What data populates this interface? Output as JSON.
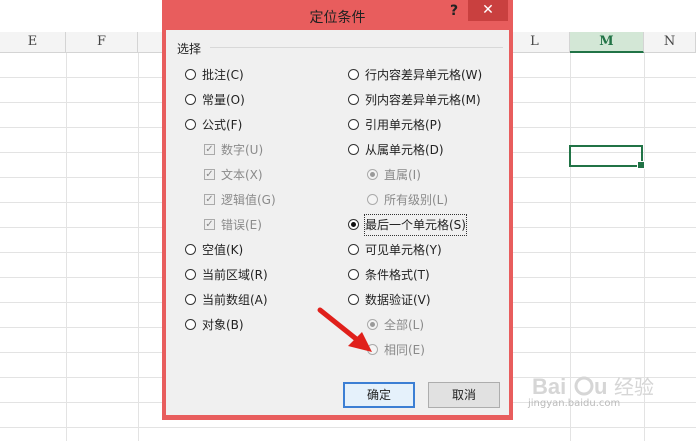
{
  "spreadsheet": {
    "columns": [
      {
        "id": "e",
        "label": "E",
        "selected": false
      },
      {
        "id": "f",
        "label": "F",
        "selected": false
      },
      {
        "id": "l",
        "label": "L",
        "selected": false
      },
      {
        "id": "m",
        "label": "M",
        "selected": true
      },
      {
        "id": "n",
        "label": "N",
        "selected": false
      }
    ]
  },
  "dialog": {
    "title": "定位条件",
    "help": "?",
    "close": "✕",
    "group_label": "选择",
    "left_options": [
      {
        "label": "批注(C)",
        "checked": false
      },
      {
        "label": "常量(O)",
        "checked": false
      },
      {
        "label": "公式(F)",
        "checked": false
      },
      {
        "label": "数字(U)",
        "checked": true
      },
      {
        "label": "文本(X)",
        "checked": true
      },
      {
        "label": "逻辑值(G)",
        "checked": true
      },
      {
        "label": "错误(E)",
        "checked": true
      },
      {
        "label": "空值(K)",
        "checked": false
      },
      {
        "label": "当前区域(R)",
        "checked": false
      },
      {
        "label": "当前数组(A)",
        "checked": false
      },
      {
        "label": "对象(B)",
        "checked": false
      }
    ],
    "right_options": [
      {
        "label": "行内容差异单元格(W)",
        "checked": false
      },
      {
        "label": "列内容差异单元格(M)",
        "checked": false
      },
      {
        "label": "引用单元格(P)",
        "checked": false
      },
      {
        "label": "从属单元格(D)",
        "checked": false
      },
      {
        "label": "直属(I)",
        "checked": true
      },
      {
        "label": "所有级别(L)",
        "checked": false
      },
      {
        "label": "最后一个单元格(S)",
        "checked": true
      },
      {
        "label": "可见单元格(Y)",
        "checked": false
      },
      {
        "label": "条件格式(T)",
        "checked": false
      },
      {
        "label": "数据验证(V)",
        "checked": false
      },
      {
        "label": "全部(L)",
        "checked": true
      },
      {
        "label": "相同(E)",
        "checked": false
      }
    ],
    "ok_label": "确定",
    "cancel_label": "取消"
  },
  "watermark": {
    "text": "Baidu 经验",
    "subtext": "jingyan.baidu.com"
  },
  "colors": {
    "dialog_frame": "#e85d5d",
    "close_button": "#c9403f",
    "selection": "#217346",
    "arrow": "#e0201b"
  }
}
